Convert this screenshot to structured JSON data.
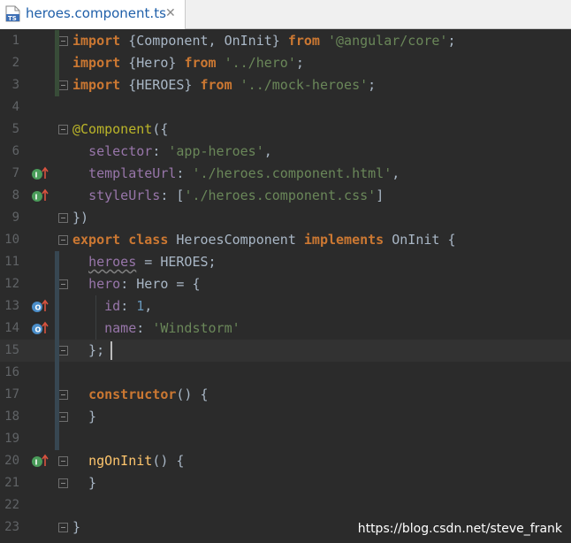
{
  "tab": {
    "icon_text": "TS",
    "title": "heroes.component.ts",
    "close_glyph": "✕"
  },
  "colors": {
    "background": "#2b2b2b",
    "keyword": "#cc7832",
    "string": "#6a8759",
    "property": "#9876aa",
    "number": "#6897bb",
    "annotation": "#bbb529",
    "function": "#ffc66d",
    "default": "#a9b7c6",
    "line_number": "#606366"
  },
  "lines": [
    {
      "n": "1",
      "tokens": [
        [
          "kw",
          "import"
        ],
        [
          "t",
          " {Component, OnInit} "
        ],
        [
          "kw",
          "from"
        ],
        [
          "t",
          " "
        ],
        [
          "str",
          "'@angular/core'"
        ],
        [
          "t",
          ";"
        ]
      ]
    },
    {
      "n": "2",
      "tokens": [
        [
          "kw",
          "import"
        ],
        [
          "t",
          " {Hero} "
        ],
        [
          "kw",
          "from"
        ],
        [
          "t",
          " "
        ],
        [
          "str",
          "'../hero'"
        ],
        [
          "t",
          ";"
        ]
      ]
    },
    {
      "n": "3",
      "tokens": [
        [
          "kw",
          "import"
        ],
        [
          "t",
          " {HEROES} "
        ],
        [
          "kw",
          "from"
        ],
        [
          "t",
          " "
        ],
        [
          "str",
          "'../mock-heroes'"
        ],
        [
          "t",
          ";"
        ]
      ]
    },
    {
      "n": "4",
      "tokens": []
    },
    {
      "n": "5",
      "tokens": [
        [
          "ann",
          "@Component"
        ],
        [
          "t",
          "({"
        ]
      ]
    },
    {
      "n": "6",
      "tokens": [
        [
          "t",
          "  "
        ],
        [
          "prop",
          "selector"
        ],
        [
          "t",
          ": "
        ],
        [
          "str",
          "'app-heroes'"
        ],
        [
          "t",
          ","
        ]
      ]
    },
    {
      "n": "7",
      "tokens": [
        [
          "t",
          "  "
        ],
        [
          "prop",
          "templateUrl"
        ],
        [
          "t",
          ": "
        ],
        [
          "str",
          "'./heroes.component.html'"
        ],
        [
          "t",
          ","
        ]
      ]
    },
    {
      "n": "8",
      "tokens": [
        [
          "t",
          "  "
        ],
        [
          "prop",
          "styleUrls"
        ],
        [
          "t",
          ": ["
        ],
        [
          "str",
          "'./heroes.component.css'"
        ],
        [
          "t",
          "]"
        ]
      ]
    },
    {
      "n": "9",
      "tokens": [
        [
          "t",
          "})"
        ]
      ]
    },
    {
      "n": "10",
      "tokens": [
        [
          "kw",
          "export"
        ],
        [
          "t",
          " "
        ],
        [
          "kw",
          "class"
        ],
        [
          "t",
          " HeroesComponent "
        ],
        [
          "kw",
          "implements"
        ],
        [
          "t",
          " OnInit {"
        ]
      ]
    },
    {
      "n": "11",
      "tokens": [
        [
          "t",
          "  "
        ],
        [
          "propw",
          "heroes"
        ],
        [
          "t",
          " = HEROES;"
        ]
      ]
    },
    {
      "n": "12",
      "tokens": [
        [
          "t",
          "  "
        ],
        [
          "prop",
          "hero"
        ],
        [
          "t",
          ": Hero = {"
        ]
      ]
    },
    {
      "n": "13",
      "tokens": [
        [
          "t",
          "    "
        ],
        [
          "prop",
          "id"
        ],
        [
          "t",
          ": "
        ],
        [
          "num",
          "1"
        ],
        [
          "t",
          ","
        ]
      ]
    },
    {
      "n": "14",
      "tokens": [
        [
          "t",
          "    "
        ],
        [
          "prop",
          "name"
        ],
        [
          "t",
          ": "
        ],
        [
          "str",
          "'Windstorm'"
        ]
      ]
    },
    {
      "n": "15",
      "tokens": [
        [
          "t",
          "  };"
        ]
      ]
    },
    {
      "n": "16",
      "tokens": []
    },
    {
      "n": "17",
      "tokens": [
        [
          "t",
          "  "
        ],
        [
          "kw",
          "constructor"
        ],
        [
          "t",
          "() {"
        ]
      ]
    },
    {
      "n": "18",
      "tokens": [
        [
          "t",
          "  }"
        ]
      ]
    },
    {
      "n": "19",
      "tokens": []
    },
    {
      "n": "20",
      "tokens": [
        [
          "t",
          "  "
        ],
        [
          "fn",
          "ngOnInit"
        ],
        [
          "t",
          "() {"
        ]
      ]
    },
    {
      "n": "21",
      "tokens": [
        [
          "t",
          "  }"
        ]
      ]
    },
    {
      "n": "22",
      "tokens": []
    },
    {
      "n": "23",
      "tokens": [
        [
          "t",
          "}"
        ]
      ]
    }
  ],
  "watermark": "https://blog.csdn.net/steve_frank"
}
